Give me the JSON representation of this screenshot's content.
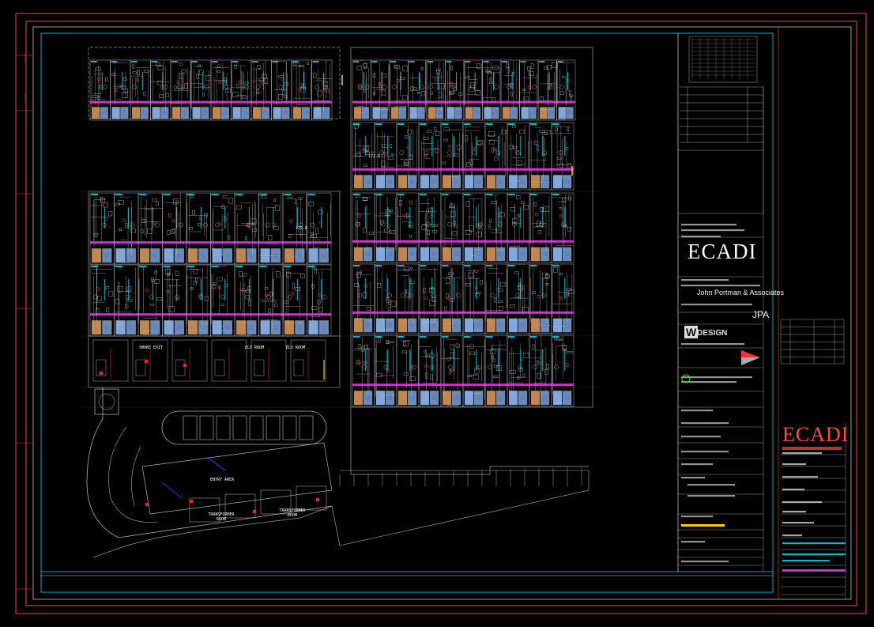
{
  "titleblock": {
    "logo_main": "ECADI",
    "logo_side": "ECADI",
    "architect": "John Portman & Associates",
    "pa_mark": "JPA",
    "wdesign": "DESIGN",
    "w_letter": "W"
  },
  "plan_labels": {
    "smoke_exit": "SMOKE EXIT",
    "room_1": "ELV ROOM",
    "room_2": "ELV ROOM",
    "entrance": "ENTRY AREA",
    "transformer_1": "TRANSFORMER ROOM",
    "transformer_2": "TRANSFORMER ROOM",
    "dim_1": "172.6",
    "dim_2": "172.6"
  },
  "colors": {
    "border": "#ff4040",
    "cyan": "#00e5ff",
    "magenta": "#ff30ff",
    "orange": "#e0a060",
    "lightblue": "#9bc4ff",
    "grey": "#b0b0b0",
    "yellow": "#ffd000",
    "white": "#ffffff"
  }
}
